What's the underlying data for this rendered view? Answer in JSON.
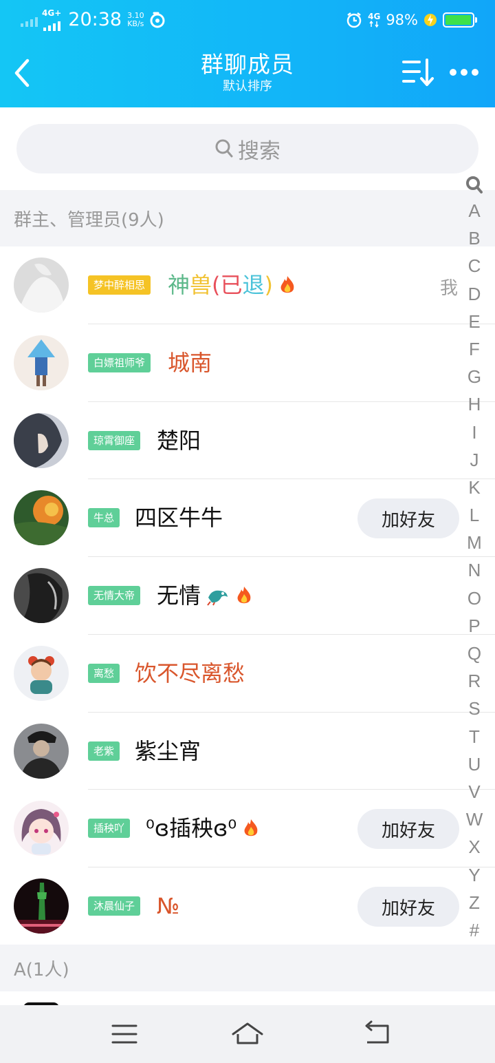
{
  "status_bar": {
    "network_left": "4G+",
    "time": "20:38",
    "speed_value": "3.10",
    "speed_unit": "KB/s",
    "network_right": "4G",
    "battery_percent": "98%",
    "battery_level": 0.98
  },
  "header": {
    "title": "群聊成员",
    "subtitle": "默认排序",
    "back_icon": "back-chevron-icon",
    "sort_icon": "sort-icon",
    "more_icon": "more-dots-icon"
  },
  "search": {
    "placeholder": "搜索"
  },
  "sections": [
    {
      "title": "群主、管理员(9人)"
    },
    {
      "title": "A(1人)"
    }
  ],
  "members": [
    {
      "badge": "梦中醉相思",
      "badge_color": "#f5c325",
      "name_parts": [
        "神",
        "兽",
        "(",
        "已",
        "退",
        ")"
      ],
      "name_colors": [
        "#5cb88a",
        "#f1c232",
        "#e8505b",
        "#e8505b",
        "#4cc3d9",
        "#f1c232"
      ],
      "fire": true,
      "me": "我",
      "add_button": ""
    },
    {
      "badge": "白嫖祖师爷",
      "badge_color": "#5fcf98",
      "name": "城南",
      "name_color": "#d9562c",
      "fire": false,
      "me": "",
      "add_button": ""
    },
    {
      "badge": "琼霄御座",
      "badge_color": "#5fcf98",
      "name": "楚阳",
      "name_color": "#111111",
      "fire": false,
      "me": "",
      "add_button": ""
    },
    {
      "badge": "牛总",
      "badge_color": "#5fcf98",
      "name": "四区牛牛",
      "name_color": "#111111",
      "fire": false,
      "me": "",
      "add_button": "加好友"
    },
    {
      "badge": "无情大帝",
      "badge_color": "#5fcf98",
      "name": "无情",
      "name_color": "#111111",
      "fire": true,
      "dragon": true,
      "me": "",
      "add_button": ""
    },
    {
      "badge": "离愁",
      "badge_color": "#5fcf98",
      "name": "饮不尽离愁",
      "name_color": "#d9562c",
      "fire": false,
      "me": "",
      "add_button": ""
    },
    {
      "badge": "老紫",
      "badge_color": "#5fcf98",
      "name": "紫尘宵",
      "name_color": "#111111",
      "fire": false,
      "me": "",
      "add_button": ""
    },
    {
      "badge": "插秧吖",
      "badge_color": "#5fcf98",
      "name": "⁰ɞ插秧ɞ⁰",
      "name_color": "#111111",
      "fire": true,
      "me": "",
      "add_button": "加好友"
    },
    {
      "badge": "沐晨仙子",
      "badge_color": "#5fcf98",
      "name": "№",
      "name_color": "#d9562c",
      "fire": false,
      "me": "",
      "add_button": "加好友"
    }
  ],
  "index_letters": [
    "A",
    "B",
    "C",
    "D",
    "E",
    "F",
    "G",
    "H",
    "I",
    "J",
    "K",
    "L",
    "M",
    "N",
    "O",
    "P",
    "Q",
    "R",
    "S",
    "T",
    "U",
    "V",
    "W",
    "X",
    "Y",
    "Z",
    "#"
  ],
  "bottom_nav": {
    "menu_icon": "menu-lines-icon",
    "home_icon": "home-icon",
    "back_icon": "return-icon"
  }
}
